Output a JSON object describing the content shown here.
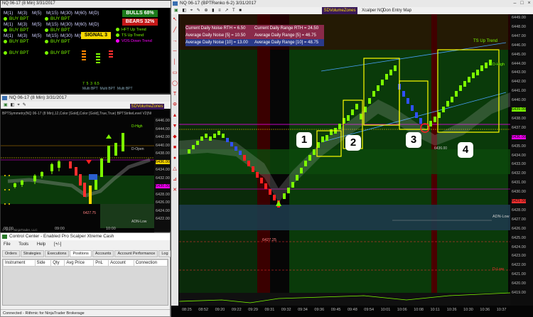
{
  "market_analyzer": {
    "rows": [
      [
        "M(1)",
        "M(3)",
        "M(5)",
        "M(15)",
        "M(30)",
        "M(60)",
        "M(D)"
      ],
      [
        "M(1)",
        "M(3)",
        "M(5)",
        "M(15)",
        "M(30)",
        "M(60)",
        "M(D)"
      ],
      [
        "M(1)",
        "M(3)",
        "M(5)",
        "M(15)",
        "M(30)",
        "M(60)",
        "M(D)"
      ]
    ],
    "title": "NQ 06-17 (8 Min)  3/31/2017",
    "signals": [
      "BUY BPT",
      "BUY BPT",
      "BUY BPT",
      "BUY BPT"
    ],
    "bulls": "BULLS 68%",
    "bears": "BEARS 32%",
    "signal_box": "SIGNAL 3",
    "trends": [
      "HFT Up Trend",
      "TS Up Trend",
      "VOS Down Trend"
    ],
    "meter_labels": [
      "Multi BPT",
      "Multi BPT",
      "Multi BPT"
    ],
    "meter_values": [
      "7",
      "5",
      "3",
      "6.5",
      "5.5",
      "4.67",
      "3.33",
      "5.5",
      "5.5",
      "6.5"
    ]
  },
  "minute_chart": {
    "title": "NQ 06-17 (8 Min)  3/31/2017",
    "indicator_line": "BPTSymmetry(NQ 06-17 (8 Min),12,Color [Gold],Color [Gold],True,True)  BPTStrikeLevel V2(NQ...",
    "badge": "SDVolumeZones",
    "d_high": "D-High",
    "d_open": "D-Open",
    "adn_low": "ADN-Low",
    "low_price": "6427.75",
    "copyright": "© 2017 NinjaTrader, LLC",
    "time_labels": [
      "08:00",
      "09:00",
      "10:00"
    ],
    "price_labels": [
      "6446.00",
      "6444.00",
      "6442.00",
      "6440.00",
      "6438.00",
      "6436.00",
      "6434.00",
      "6432.00",
      "6430.00",
      "6428.00",
      "6426.00",
      "6424.00",
      "6422.00"
    ]
  },
  "control_center": {
    "title": "Control Center - Enabled Pro Scalper Xtreme Cash",
    "menu": [
      "File",
      "Tools",
      "Help",
      "[+/-]"
    ],
    "tabs": [
      "Orders",
      "Strategies",
      "Executions",
      "Positions",
      "Accounts",
      "Account Performance",
      "Log"
    ],
    "columns": [
      "Instrument",
      "Side",
      "Qty",
      "Avg Price",
      "PnL",
      "Account",
      "Connection"
    ],
    "status": "Connected - Rithmic for NinjaTrader Brokerage"
  },
  "renko_chart": {
    "title": "NQ 06-17 (BPTRenko 6-2)  3/31/2017",
    "badge": "SDVolumeZones",
    "toolbar_tail": [
      "Xcalper NQ",
      "Don Entry Map"
    ],
    "stats_left": [
      "Current Daily Noise RTH = 6.50",
      "Average Daily Noise [5] = 10.50",
      "Average Daily Noise [10] = 13.00"
    ],
    "stats_right": [
      "Current Daily Range RTH = 24.50",
      "Average Daily Range [5] = 46.75",
      "Average Daily Range [10] = 48.75"
    ],
    "ts_up_trend": "TS Up Trend",
    "d_high": "D-High",
    "adn_low": "ADN-Low",
    "dulow": "D-Low",
    "low_price": "6427.25",
    "mid_price": "6436.00",
    "number_labels": [
      "1",
      "2",
      "3",
      "4"
    ],
    "time_labels": [
      "08:25",
      "08:52",
      "09:20",
      "09:22",
      "09:29",
      "09:31",
      "09:32",
      "09:34",
      "09:36",
      "09:45",
      "09:48",
      "09:54",
      "10:01",
      "10:06",
      "10:08",
      "10:11",
      "10:26",
      "10:30",
      "10:36",
      "10:37"
    ],
    "price_labels": [
      "6449.00",
      "6448.00",
      "6447.00",
      "6446.00",
      "6445.00",
      "6444.00",
      "6443.00",
      "6442.00",
      "6441.00",
      "6440.00",
      "6439.00",
      "6438.00",
      "6437.00",
      "6436.00",
      "6435.00",
      "6434.00",
      "6433.00",
      "6432.00",
      "6431.00",
      "6430.00",
      "6429.00",
      "6428.00",
      "6427.00",
      "6426.00",
      "6425.00",
      "6424.00",
      "6423.00",
      "6422.00",
      "6421.00",
      "6420.00",
      "6419.00"
    ]
  },
  "colors": {
    "bull_green": "#7CFC00",
    "bear_red": "#ff2020",
    "highlight_yellow": "#ffff00",
    "zone_green": "#0a3d0a",
    "zone_red": "#5a0000",
    "magenta": "#ff00ff"
  }
}
